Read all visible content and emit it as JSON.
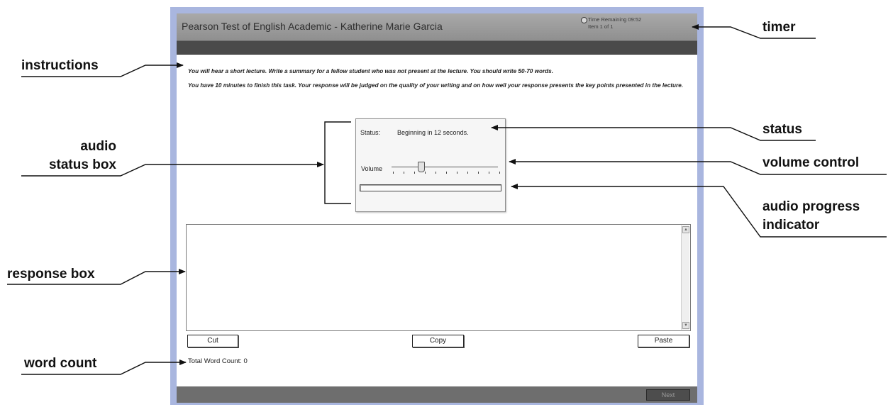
{
  "app": {
    "title": "Pearson Test of English Academic - Katherine Marie Garcia",
    "timer_text": "Time Remaining 09:52",
    "item_text": "Item 1 of 1"
  },
  "instructions": {
    "line1": "You will hear a short lecture. Write a summary for a fellow student who was not present at the lecture. You should write 50-70 words.",
    "line2": "You have 10 minutes to finish this task. Your response will be judged on the quality of your writing and on how well your response presents the key points presented in the lecture."
  },
  "audio": {
    "status_label": "Status:",
    "status_value": "Beginning in 12 seconds.",
    "volume_label": "Volume",
    "volume_level": 0.27,
    "progress": 0.0
  },
  "response": {
    "value": ""
  },
  "buttons": {
    "cut": "Cut",
    "copy": "Copy",
    "paste": "Paste",
    "next": "Next"
  },
  "word_count": {
    "label": "Total Word Count:",
    "value": "0"
  },
  "annotations": {
    "instructions": "instructions",
    "timer": "timer",
    "audio_status_box_line1": "audio",
    "audio_status_box_line2": "status box",
    "status": "status",
    "volume_control": "volume control",
    "audio_progress_line1": "audio progress",
    "audio_progress_line2": "indicator",
    "response_box": "response box",
    "word_count": "word count"
  },
  "colors": {
    "frame": "#a9b6df",
    "titlebar": "#9a9a9a",
    "toolbar": "#4a4a4a",
    "footer": "#6e6e6e"
  }
}
